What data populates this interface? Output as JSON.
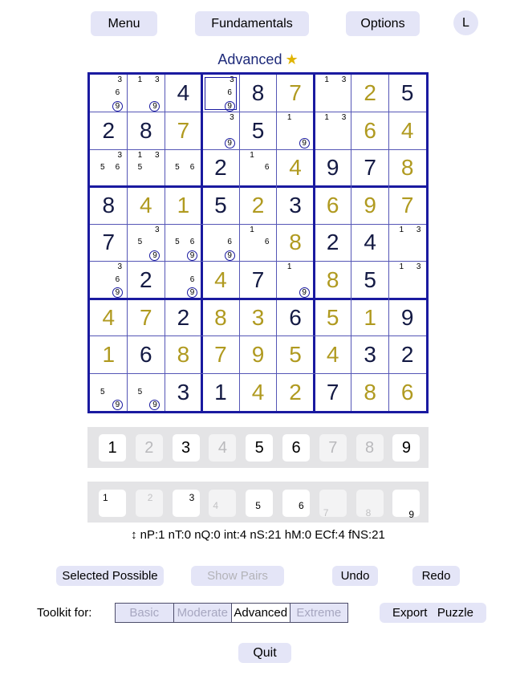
{
  "header": {
    "menu_label": "Menu",
    "fundamentals_label": "Fundamentals",
    "options_label": "Options",
    "avatar_letter": "L"
  },
  "level": {
    "label": "Advanced",
    "star": "★"
  },
  "grid": [
    [
      {
        "c": [
          3,
          6,
          9
        ],
        "r": [
          9
        ]
      },
      {
        "c": [
          1,
          3,
          9
        ],
        "r": [
          9
        ]
      },
      {
        "v": 4,
        "t": "g"
      },
      {
        "c": [
          3,
          6,
          9
        ],
        "r": [
          9
        ],
        "sel": true
      },
      {
        "v": 8,
        "t": "g"
      },
      {
        "v": 7,
        "t": "s"
      },
      {
        "c": [
          1,
          3
        ]
      },
      {
        "v": 2,
        "t": "s"
      },
      {
        "v": 5,
        "t": "g"
      }
    ],
    [
      {
        "v": 2,
        "t": "g"
      },
      {
        "v": 8,
        "t": "g"
      },
      {
        "v": 7,
        "t": "s"
      },
      {
        "c": [
          3,
          9
        ],
        "r": [
          9
        ]
      },
      {
        "v": 5,
        "t": "g"
      },
      {
        "c": [
          1,
          9
        ],
        "r": [
          9
        ]
      },
      {
        "c": [
          1,
          3
        ]
      },
      {
        "v": 6,
        "t": "s"
      },
      {
        "v": 4,
        "t": "s"
      }
    ],
    [
      {
        "c": [
          3,
          5,
          6
        ]
      },
      {
        "c": [
          1,
          3,
          5
        ]
      },
      {
        "c": [
          5,
          6
        ]
      },
      {
        "v": 2,
        "t": "g"
      },
      {
        "c": [
          1,
          6
        ]
      },
      {
        "v": 4,
        "t": "s"
      },
      {
        "v": 9,
        "t": "g"
      },
      {
        "v": 7,
        "t": "g"
      },
      {
        "v": 8,
        "t": "s"
      }
    ],
    [
      {
        "v": 8,
        "t": "g"
      },
      {
        "v": 4,
        "t": "s"
      },
      {
        "v": 1,
        "t": "s"
      },
      {
        "v": 5,
        "t": "g"
      },
      {
        "v": 2,
        "t": "s"
      },
      {
        "v": 3,
        "t": "g"
      },
      {
        "v": 6,
        "t": "s"
      },
      {
        "v": 9,
        "t": "s"
      },
      {
        "v": 7,
        "t": "s"
      }
    ],
    [
      {
        "v": 7,
        "t": "g"
      },
      {
        "c": [
          3,
          5,
          9
        ],
        "r": [
          9
        ]
      },
      {
        "c": [
          5,
          6,
          9
        ],
        "r": [
          9
        ]
      },
      {
        "c": [
          6,
          9
        ],
        "r": [
          9
        ]
      },
      {
        "c": [
          1,
          6
        ]
      },
      {
        "v": 8,
        "t": "s"
      },
      {
        "v": 2,
        "t": "g"
      },
      {
        "v": 4,
        "t": "g"
      },
      {
        "c": [
          1,
          3
        ]
      }
    ],
    [
      {
        "c": [
          3,
          6,
          9
        ],
        "r": [
          9
        ]
      },
      {
        "v": 2,
        "t": "g"
      },
      {
        "c": [
          6,
          9
        ],
        "r": [
          9
        ]
      },
      {
        "v": 4,
        "t": "s"
      },
      {
        "v": 7,
        "t": "g"
      },
      {
        "c": [
          1,
          9
        ],
        "r": [
          9
        ]
      },
      {
        "v": 8,
        "t": "s"
      },
      {
        "v": 5,
        "t": "g"
      },
      {
        "c": [
          1,
          3
        ]
      }
    ],
    [
      {
        "v": 4,
        "t": "s"
      },
      {
        "v": 7,
        "t": "s"
      },
      {
        "v": 2,
        "t": "g"
      },
      {
        "v": 8,
        "t": "s"
      },
      {
        "v": 3,
        "t": "s"
      },
      {
        "v": 6,
        "t": "g"
      },
      {
        "v": 5,
        "t": "s"
      },
      {
        "v": 1,
        "t": "s"
      },
      {
        "v": 9,
        "t": "g"
      }
    ],
    [
      {
        "v": 1,
        "t": "s"
      },
      {
        "v": 6,
        "t": "g"
      },
      {
        "v": 8,
        "t": "s"
      },
      {
        "v": 7,
        "t": "s"
      },
      {
        "v": 9,
        "t": "s"
      },
      {
        "v": 5,
        "t": "s"
      },
      {
        "v": 4,
        "t": "s"
      },
      {
        "v": 3,
        "t": "g"
      },
      {
        "v": 2,
        "t": "g"
      }
    ],
    [
      {
        "c": [
          5,
          9
        ],
        "r": [
          9
        ]
      },
      {
        "c": [
          5,
          9
        ],
        "r": [
          9
        ]
      },
      {
        "v": 3,
        "t": "g"
      },
      {
        "v": 1,
        "t": "g"
      },
      {
        "v": 4,
        "t": "s"
      },
      {
        "v": 2,
        "t": "s"
      },
      {
        "v": 7,
        "t": "g"
      },
      {
        "v": 8,
        "t": "s"
      },
      {
        "v": 6,
        "t": "s"
      }
    ]
  ],
  "number_pad": [
    {
      "label": "1",
      "enabled": true
    },
    {
      "label": "2",
      "enabled": false
    },
    {
      "label": "3",
      "enabled": true
    },
    {
      "label": "4",
      "enabled": false
    },
    {
      "label": "5",
      "enabled": true
    },
    {
      "label": "6",
      "enabled": true
    },
    {
      "label": "7",
      "enabled": false
    },
    {
      "label": "8",
      "enabled": false
    },
    {
      "label": "9",
      "enabled": true
    }
  ],
  "pencil_pad": [
    {
      "label": "1",
      "enabled": true
    },
    {
      "label": "2",
      "enabled": false
    },
    {
      "label": "3",
      "enabled": true
    },
    {
      "label": "4",
      "enabled": false
    },
    {
      "label": "5",
      "enabled": true
    },
    {
      "label": "6",
      "enabled": true
    },
    {
      "label": "7",
      "enabled": false
    },
    {
      "label": "8",
      "enabled": false
    },
    {
      "label": "9",
      "enabled": true
    }
  ],
  "stats": {
    "arrow": "↕",
    "text": "nP:1  nT:0  nQ:0  int:4  nS:21  hM:0  ECf:4  fNS:21"
  },
  "actions": {
    "selected_possible": "Selected Possible",
    "show_pairs": "Show Pairs",
    "undo": "Undo",
    "redo": "Redo"
  },
  "toolkit": {
    "label": "Toolkit for:",
    "options": [
      "Basic",
      "Moderate",
      "Advanced",
      "Extreme"
    ],
    "selected": "Advanced"
  },
  "export_label": "Export   Puzzle",
  "quit_label": "Quit",
  "colors": {
    "accent": "#1a1aa0",
    "given": "#141a44",
    "solved": "#b09a20",
    "button_bg": "#e4e5f7"
  }
}
